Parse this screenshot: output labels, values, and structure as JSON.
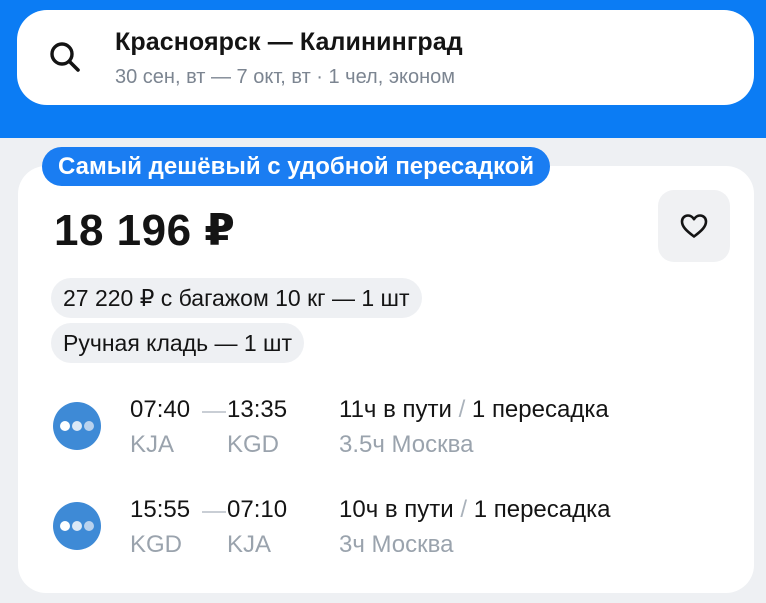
{
  "search": {
    "route": "Красноярск — Калининград",
    "details": "30 сен, вт — 7 окт, вт · 1 чел, эконом"
  },
  "offer": {
    "badge": "Самый дешёвый с удобной пересадкой",
    "price": "18 196 ₽",
    "baggage_option": "27 220 ₽ с багажом 10 кг — 1 шт",
    "hand_luggage": "Ручная кладь — 1 шт"
  },
  "segments": [
    {
      "depart_time": "07:40",
      "arrive_time": "13:35",
      "from_code": "KJA",
      "to_code": "KGD",
      "duration": "11ч в пути",
      "separator": "/",
      "transfers": "1 пересадка",
      "stopover": "3.5ч Москва"
    },
    {
      "depart_time": "15:55",
      "arrive_time": "07:10",
      "from_code": "KGD",
      "to_code": "KJA",
      "duration": "10ч в пути",
      "separator": "/",
      "transfers": "1 пересадка",
      "stopover": "3ч Москва"
    }
  ],
  "icons": {
    "search": "search-icon",
    "favorite": "heart-icon",
    "carrier": "carrier-logo-icon"
  },
  "colors": {
    "header_blue": "#0b7cf4",
    "badge_blue": "#1a7df2",
    "carrier_logo": "#3e8ad6",
    "muted_text": "#9aa3ad"
  }
}
